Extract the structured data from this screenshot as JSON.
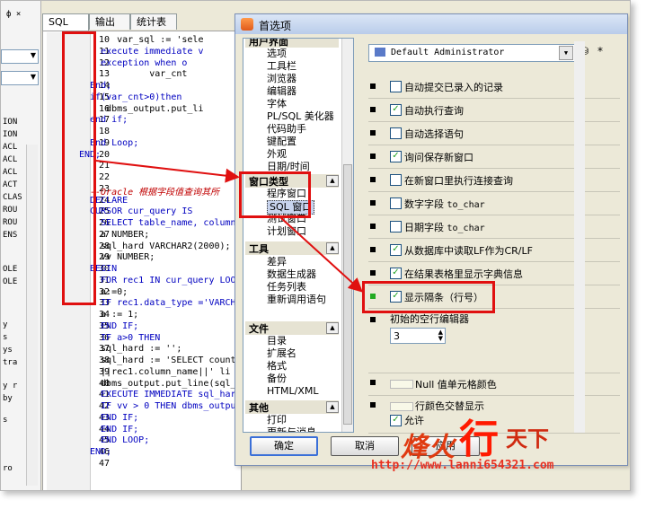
{
  "left_panel": {
    "pin": "ф ×",
    "items": [
      "ION",
      "ION",
      "ACL",
      "ACL",
      "ACL",
      "ACT",
      "CLAS",
      "ROU",
      "ROU",
      "ENS",
      "OLE",
      "OLE",
      "y",
      "s",
      "ys",
      "tra",
      "y r",
      "by",
      "s",
      "ro"
    ]
  },
  "tabs": [
    "SQL",
    "输出",
    "统计表"
  ],
  "editor": {
    "line_numbers": [
      "10",
      "11",
      "12",
      "13",
      "14",
      "15",
      "16",
      "17",
      "18",
      "19",
      "20",
      "21",
      "22",
      "23",
      "24",
      "25",
      "26",
      "27",
      "28",
      "29",
      "30",
      "31",
      "32",
      "33",
      "34",
      "35",
      "36",
      "37",
      "38",
      "39",
      "40",
      "41",
      "42",
      "43",
      "44",
      "45",
      "46",
      "47"
    ],
    "lines": [
      "       var_sql := 'sele",
      "    execute immediate v",
      "    exception when o",
      "             var_cnt",
      "  End;",
      "  if(var_cnt>0)then",
      "     dbms_output.put_li",
      "  end if;",
      "",
      "  End Loop;",
      "END;",
      "",
      "",
      "--Oracle 根据字段值查询其所",
      "DECLARE",
      "CURSOR cur_query IS",
      "  SELECT table_name, column",
      "  a NUMBER;",
      "  sql_hard VARCHAR2(2000);",
      "  vv NUMBER;",
      "BEGIN",
      "  FOR rec1 IN cur_query LOO",
      "  a:=0;",
      "  IF rec1.data_type ='VARCH",
      "  a := 1;",
      "  END IF;",
      "  IF a>0 THEN",
      "  sql_hard := '';",
      "  sql_hard := 'SELECT count",
      "  ||rec1.column_name||' li",
      "  dbms_output.put_line(sql_",
      "  EXECUTE IMMEDIATE sql_har",
      "  IF vv > 0 THEN dbms_outpu",
      "  END IF;",
      "  END IF;",
      "  END LOOP;",
      "END;",
      ""
    ]
  },
  "dialog": {
    "title": "首选项",
    "tree": {
      "top_cutoff": "用户界面",
      "ui_items": [
        "选项",
        "工具栏",
        "浏览器",
        "编辑器",
        "字体",
        "PL/SQL 美化器",
        "代码助手",
        "键配置",
        "外观",
        "日期/时间"
      ],
      "window_type": {
        "label": "窗口类型",
        "items": [
          "程序窗口",
          "SQL 窗口",
          "测试窗口",
          "计划窗口"
        ]
      },
      "tools": {
        "label": "工具",
        "items": [
          "差异",
          "数据生成器",
          "任务列表",
          "重新调用语句"
        ]
      },
      "files": {
        "label": "文件",
        "items": [
          "目录",
          "扩展名",
          "格式",
          "备份",
          "HTML/XML"
        ]
      },
      "other": {
        "label": "其他",
        "items": [
          "打印",
          "更新与消息"
        ]
      }
    },
    "profile": "Default Administrator",
    "profile_extra": "*",
    "options": [
      {
        "label": "自动提交已录入的记录",
        "checked": false
      },
      {
        "label": "自动执行查询",
        "checked": true
      },
      {
        "label": "自动选择语句",
        "checked": false
      },
      {
        "label": "询问保存新窗口",
        "checked": true
      },
      {
        "label": "在新窗口里执行连接查询",
        "checked": false
      },
      {
        "label": "数字字段 ",
        "mono": "to_char",
        "checked": false
      },
      {
        "label": "日期字段 ",
        "mono": "to_char",
        "checked": false
      },
      {
        "label": "从数据库中读取LF作为CR/LF",
        "checked": true
      },
      {
        "label": "在结果表格里显示字典信息",
        "checked": true
      },
      {
        "label": "显示隔条（行号）",
        "checked": true
      }
    ],
    "initial_rows_label": "初始的空行编辑器",
    "initial_rows_value": "3",
    "null_color_label": "Null 值单元格颜色",
    "alt_color_label": "行颜色交替显示",
    "allow_label": "允许",
    "allow_checked": true,
    "buttons": {
      "ok": "确定",
      "cancel": "取消",
      "apply": "应用"
    }
  },
  "watermark": {
    "brand1": "烽火",
    "brand2": "行",
    "brand3": "天下",
    "url": "http://www.lanni654321.com"
  }
}
